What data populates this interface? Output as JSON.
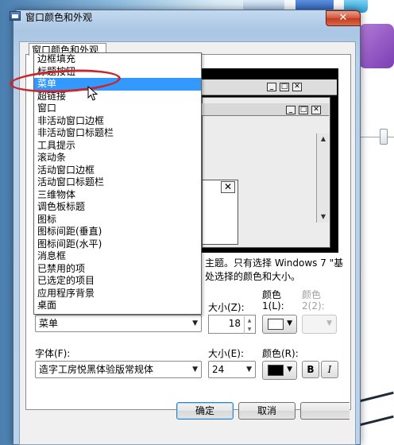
{
  "window": {
    "title": "窗口颜色和外观",
    "close_glyph": "✕"
  },
  "tab": {
    "label": "窗口颜色和外观"
  },
  "description": {
    "line1": "主题。只有选择 Windows 7 \"基",
    "line2": "处选择的颜色和大小。"
  },
  "item_list": {
    "options": [
      "边框填充",
      "标题按钮",
      "菜单",
      "超链接",
      "窗口",
      "非活动窗口边框",
      "非活动窗口标题栏",
      "工具提示",
      "滚动条",
      "活动窗口边框",
      "活动窗口标题栏",
      "三维物体",
      "调色板标题",
      "图标",
      "图标间距(垂直)",
      "图标间距(水平)",
      "消息框",
      "已禁用的项",
      "已选定的项目",
      "应用程序背景",
      "桌面"
    ],
    "selected": "菜单"
  },
  "item": {
    "selected_value": "菜单",
    "size_label": "大小(Z):",
    "size_value": "18",
    "color1_label_line1": "颜色",
    "color1_label_line2": "1(L):",
    "color2_label_line1": "颜色",
    "color2_label_line2": "2(2):"
  },
  "font": {
    "label": "字体(F):",
    "value": "造字工房悦黑体验版常规体",
    "size_label": "大小(E):",
    "size_value": "24",
    "color_label": "颜色(R):",
    "bold_label": "B",
    "italic_label": "I"
  },
  "buttons": {
    "ok": "确定",
    "cancel": "取消"
  },
  "colors": {
    "item_color1": "#ffffff",
    "font_color": "#000000",
    "selection": "#3399ff",
    "annotation": "#c8282c"
  }
}
